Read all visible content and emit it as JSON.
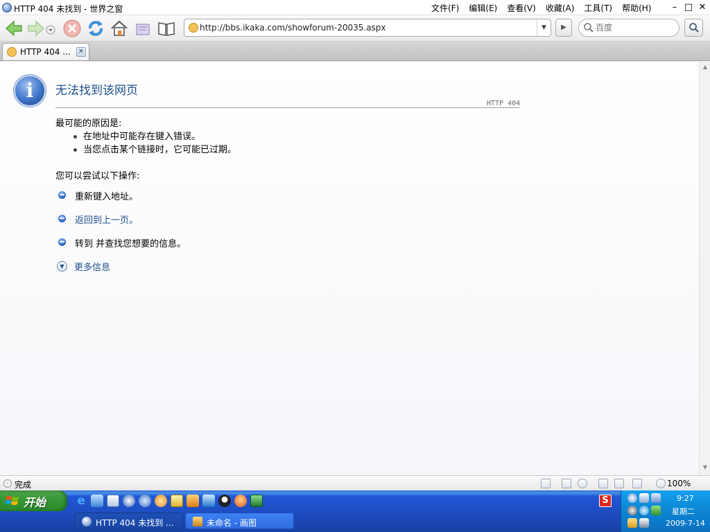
{
  "window": {
    "title": "HTTP 404 未找到 - 世界之窗",
    "menu": [
      "文件(F)",
      "编辑(E)",
      "查看(V)",
      "收藏(A)",
      "工具(T)",
      "帮助(H)"
    ],
    "controls": {
      "minimize": "–",
      "maximize": "□",
      "close": "✕"
    }
  },
  "toolbar": {
    "address_url": "http://bbs.ikaka.com/showforum-20035.aspx",
    "address_dropdown": "▼",
    "go_arrow": "▶",
    "search_placeholder": "百度"
  },
  "tab": {
    "label": "HTTP 404 ...",
    "close": "✕"
  },
  "page": {
    "icon_letter": "i",
    "title": "无法找到该网页",
    "code": "HTTP 404",
    "reason_heading": "最可能的原因是:",
    "reasons": [
      "在地址中可能存在键入错误。",
      "当您点击某个链接时，它可能已过期。"
    ],
    "try_heading": "您可以尝试以下操作:",
    "actions": [
      {
        "text": "重新键入地址。"
      },
      {
        "text": "返回到上一页。"
      },
      {
        "text": "转到   并查找您想要的信息。"
      }
    ],
    "more_info": "更多信息",
    "more_info_icon": "▼"
  },
  "status": {
    "text": "完成",
    "zoom": "100%"
  },
  "taskbar": {
    "start_label": "开始",
    "tasks": [
      {
        "label": "HTTP 404 未找到 ..."
      },
      {
        "label": "未命名 - 画图"
      }
    ],
    "ime": "S",
    "clock_time": "9:27",
    "clock_weekday": "星期二",
    "clock_date": "2009-7-14"
  },
  "scrollbar": {
    "up": "▲",
    "down": "▼"
  }
}
